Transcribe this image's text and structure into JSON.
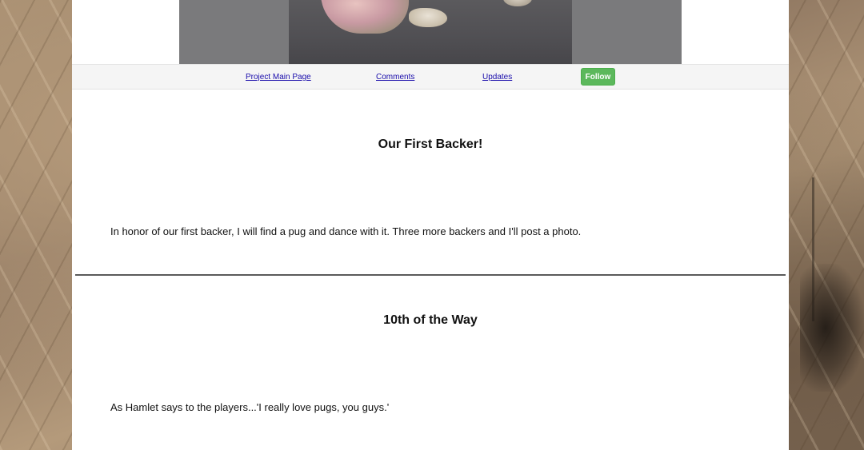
{
  "nav": {
    "main_page_label": "Project Main Page",
    "comments_label": "Comments",
    "updates_label": "Updates",
    "follow_label": "Follow"
  },
  "updates": [
    {
      "title": "Our First Backer!",
      "body": "In honor of our first backer, I will find a pug and dance with it. Three more backers and I'll post a photo."
    },
    {
      "title": "10th of the Way",
      "body": "As Hamlet says to the players...'I really love pugs, you guys.'"
    }
  ],
  "colors": {
    "follow_button": "#5cb85c",
    "link": "#1a0dab",
    "nav_background": "#f5f5f5",
    "divider": "#5a5a5a"
  }
}
